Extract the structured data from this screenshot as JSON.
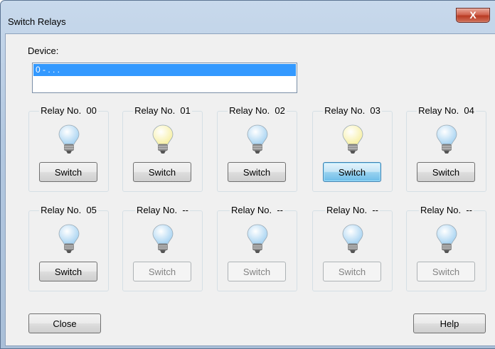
{
  "window": {
    "title": "Switch Relays",
    "close_glyph": "X"
  },
  "device": {
    "label": "Device:",
    "items": [
      "0 - . . ."
    ]
  },
  "relays": [
    {
      "label": "Relay No.  00",
      "state": "off",
      "button": "Switch",
      "enabled": true,
      "focused": false
    },
    {
      "label": "Relay No.  01",
      "state": "on",
      "button": "Switch",
      "enabled": true,
      "focused": false
    },
    {
      "label": "Relay No.  02",
      "state": "off",
      "button": "Switch",
      "enabled": true,
      "focused": false
    },
    {
      "label": "Relay No.  03",
      "state": "on",
      "button": "Switch",
      "enabled": true,
      "focused": true
    },
    {
      "label": "Relay No.  04",
      "state": "off",
      "button": "Switch",
      "enabled": true,
      "focused": false
    },
    {
      "label": "Relay No.  05",
      "state": "off",
      "button": "Switch",
      "enabled": true,
      "focused": false
    },
    {
      "label": "Relay No.  --",
      "state": "off",
      "button": "Switch",
      "enabled": false,
      "focused": false
    },
    {
      "label": "Relay No.  --",
      "state": "off",
      "button": "Switch",
      "enabled": false,
      "focused": false
    },
    {
      "label": "Relay No.  --",
      "state": "off",
      "button": "Switch",
      "enabled": false,
      "focused": false
    },
    {
      "label": "Relay No.  --",
      "state": "off",
      "button": "Switch",
      "enabled": false,
      "focused": false
    }
  ],
  "footer": {
    "close_label": "Close",
    "help_label": "Help"
  },
  "colors": {
    "bulb_off": "#a9d4f2",
    "bulb_on": "#f7f0a6",
    "selection": "#3399ff"
  },
  "icons": {
    "bulb": "light-bulb-icon",
    "close": "close-icon"
  }
}
